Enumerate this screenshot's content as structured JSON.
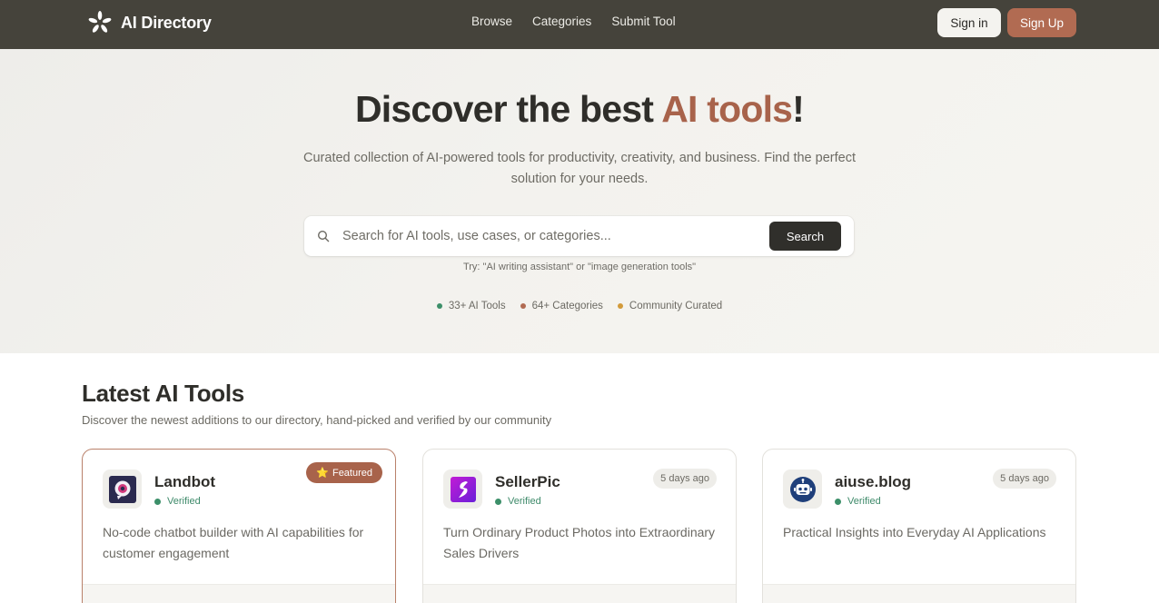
{
  "nav": {
    "brand": "AI Directory",
    "links": [
      "Browse",
      "Categories",
      "Submit Tool"
    ],
    "signin_label": "Sign in",
    "signup_label": "Sign Up"
  },
  "hero": {
    "title_part1": "Discover the best ",
    "title_accent": "AI tools",
    "title_end": "!",
    "subtitle": "Curated collection of AI-powered tools for productivity, creativity, and business. Find the perfect solution for your needs.",
    "search_placeholder": "Search for AI tools, use cases, or categories...",
    "search_button": "Search",
    "hint": "Try: \"AI writing assistant\" or \"image generation tools\"",
    "stats": [
      {
        "label": "33+ AI Tools",
        "color": "#3c8f69"
      },
      {
        "label": "64+ Categories",
        "color": "#b16b52"
      },
      {
        "label": "Community Curated",
        "color": "#d29a3a"
      }
    ]
  },
  "latest": {
    "title": "Latest AI Tools",
    "subtitle": "Discover the newest additions to our directory, hand-picked and verified by our community",
    "cards": [
      {
        "name": "Landbot",
        "verified": "Verified",
        "badge": "Featured",
        "badge_icon": "star-icon",
        "description": "No-code chatbot builder with AI capabilities for customer engagement",
        "icon": "landbot-logo-icon"
      },
      {
        "name": "SellerPic",
        "verified": "Verified",
        "badge": "5 days ago",
        "description": "Turn Ordinary Product Photos into Extraordinary Sales Drivers",
        "icon": "sellerpic-logo-icon"
      },
      {
        "name": "aiuse.blog",
        "verified": "Verified",
        "badge": "5 days ago",
        "description": "Practical Insights into Everyday AI Applications",
        "icon": "robot-icon"
      }
    ]
  },
  "colors": {
    "nav_bg": "#45433b",
    "accent": "#a8634b",
    "signup_bg": "#b16b52",
    "verified": "#3c8f69"
  }
}
